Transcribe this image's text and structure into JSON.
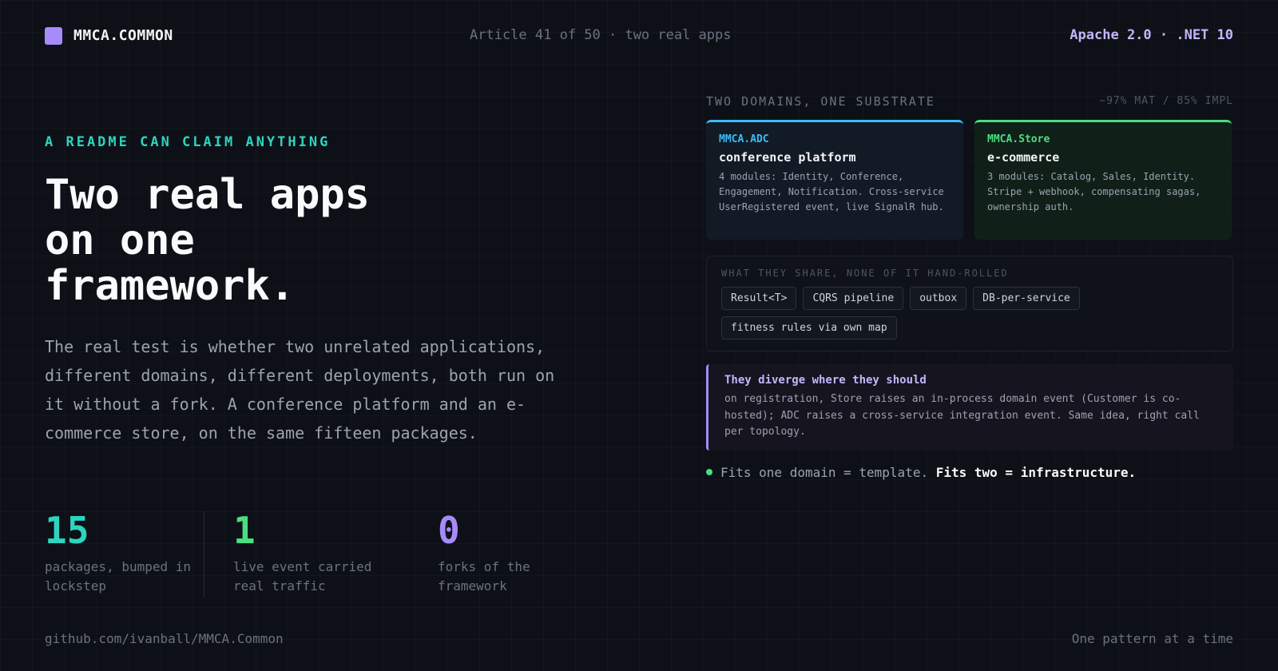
{
  "header": {
    "brand": "MMCA.COMMON",
    "article_info": "Article 41 of 50 · two real apps",
    "license_info": "Apache 2.0 · .NET 10"
  },
  "hero": {
    "eyebrow": "A README CAN CLAIM ANYTHING",
    "headline": [
      "Two real apps",
      "on one",
      "framework."
    ],
    "lede": "The real test is whether two unrelated applications, different domains, different deployments, both run on it without a fork. A conference platform and an e-commerce store, on the same fifteen packages."
  },
  "stats": [
    {
      "value": "15",
      "label": "packages, bumped in lockstep",
      "color": "#2dd4bf"
    },
    {
      "value": "1",
      "label": "live event carried real traffic",
      "color": "#4ade80"
    },
    {
      "value": "0",
      "label": "forks of the framework",
      "color": "#a78bfa"
    }
  ],
  "footer": {
    "repo": "github.com/ivanball/MMCA.Common",
    "tagline": "One pattern at a time"
  },
  "panel": {
    "section_label": "TWO DOMAINS, ONE SUBSTRATE",
    "section_meta": "~97% MAT / 85% IMPL",
    "cards": [
      {
        "tag": "MMCA.ADC",
        "title": "conference platform",
        "body": "4 modules: Identity, Conference, Engagement, Notification. Cross-service UserRegistered event, live SignalR hub.",
        "accent": "#38bdf8"
      },
      {
        "tag": "MMCA.Store",
        "title": "e-commerce",
        "body": "3 modules: Catalog, Sales, Identity. Stripe + webhook, compensating sagas, ownership auth.",
        "accent": "#4ade80"
      }
    ],
    "share": {
      "label": "WHAT THEY SHARE, NONE OF IT HAND-ROLLED",
      "chips": [
        "Result<T>",
        "CQRS pipeline",
        "outbox",
        "DB-per-service",
        "fitness rules via own map"
      ]
    },
    "callout": {
      "title": "They diverge where they should",
      "body": "on registration, Store raises an in-process domain event (Customer is co-hosted); ADC raises a cross-service integration event. Same idea, right call per topology."
    },
    "bottom": {
      "lead": "Fits one domain = template.",
      "strong": "Fits two = infrastructure."
    }
  }
}
